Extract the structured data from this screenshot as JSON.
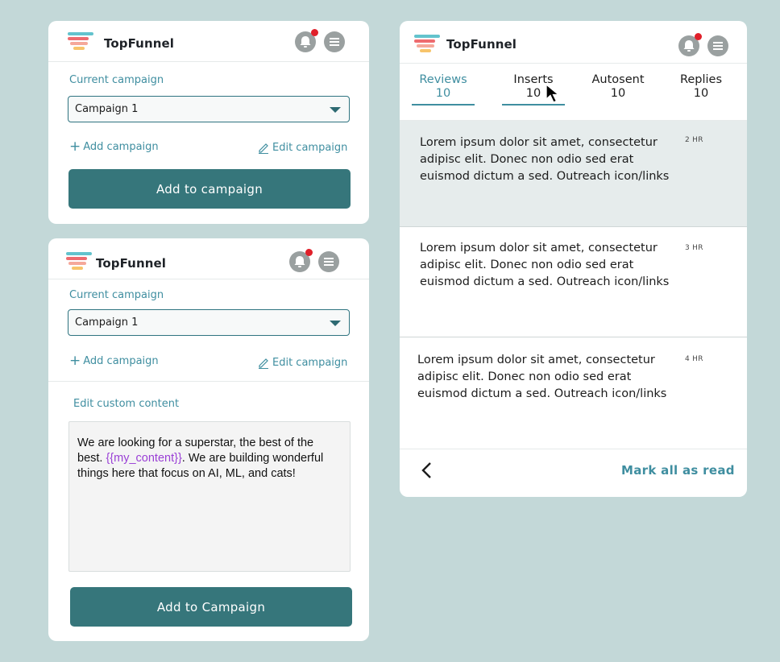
{
  "brand": "TopFunnel",
  "colors": {
    "accent": "#3f8ea0",
    "button": "#36767b",
    "notification": "#e0202a",
    "variable": "#9a3fd6"
  },
  "icons": {
    "notification": "bell-icon",
    "menu": "menu-icon",
    "edit": "pencil-icon",
    "back": "chevron-left-icon",
    "cursor": "mouse-pointer-icon"
  },
  "panel1": {
    "current_campaign_label": "Current campaign",
    "selected_campaign": "Campaign 1",
    "add_campaign": "Add campaign",
    "edit_campaign": "Edit campaign",
    "primary_button": "Add to campaign"
  },
  "panel2": {
    "current_campaign_label": "Current campaign",
    "selected_campaign": "Campaign 1",
    "add_campaign": "Add campaign",
    "edit_campaign": "Edit campaign",
    "edit_content_label": "Edit custom content",
    "content_before": "We are looking for a superstar, the best of the best. ",
    "content_variable": "{{my_content}}",
    "content_after": ". We are building wonderful things here that focus on AI, ML, and cats!",
    "primary_button": "Add to Campaign"
  },
  "panel3": {
    "tabs": [
      {
        "label": "Reviews",
        "count": "10"
      },
      {
        "label": "Inserts",
        "count": "10"
      },
      {
        "label": "Autosent",
        "count": "10"
      },
      {
        "label": "Replies",
        "count": "10"
      }
    ],
    "messages": [
      {
        "text": "Lorem ipsum dolor sit amet, consectetur adipisc elit. Donec non odio sed erat euismod dictum a sed. Outreach icon/links",
        "time": "2 HR"
      },
      {
        "text": "Lorem ipsum dolor sit amet, consectetur adipisc elit. Donec non odio sed erat euismod dictum a sed. Outreach icon/links",
        "time": "3 HR"
      },
      {
        "text": "Lorem ipsum dolor sit amet, consectetur adipisc elit. Donec non odio sed erat euismod dictum a sed. Outreach icon/links",
        "time": "4 HR"
      }
    ],
    "mark_all_read": "Mark all as read"
  }
}
